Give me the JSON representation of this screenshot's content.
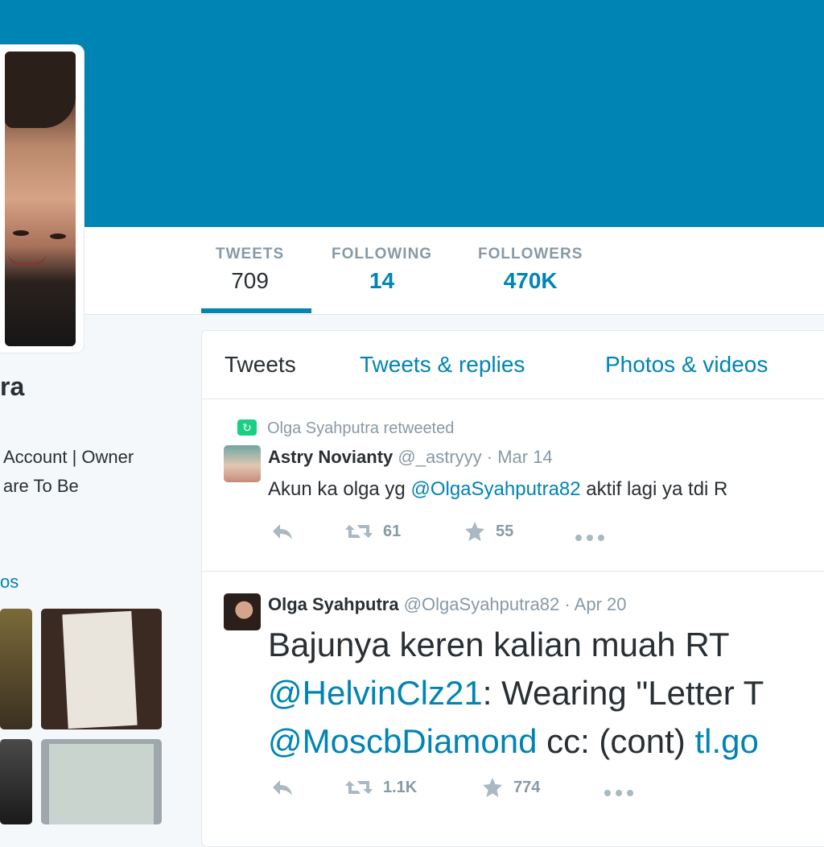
{
  "colors": {
    "banner": "#0084b4",
    "link": "#0084b4",
    "retweet": "#19cf86",
    "muted": "#8899a6"
  },
  "profile": {
    "name_partial": "ra",
    "bio_lines": [
      "Account | Owner",
      "are To Be"
    ],
    "photos_link_partial": "os"
  },
  "stats": [
    {
      "label": "TWEETS",
      "value": "709"
    },
    {
      "label": "FOLLOWING",
      "value": "14"
    },
    {
      "label": "FOLLOWERS",
      "value": "470K"
    }
  ],
  "tabs": [
    "Tweets",
    "Tweets & replies",
    "Photos & videos"
  ],
  "tweets": [
    {
      "retweet_note": "Olga Syahputra retweeted",
      "name": "Astry Novianty",
      "handle": "@_astryyy",
      "sep": "·",
      "date": "Mar 14",
      "text_before": "Akun ka olga yg ",
      "mention": "@OlgaSyahputra82",
      "text_after": " aktif lagi ya tdi R",
      "retweets": "61",
      "favorites": "55"
    },
    {
      "name": "Olga Syahputra",
      "handle": "@OlgaSyahputra82",
      "sep": "·",
      "date": "Apr 20",
      "line1": "Bajunya keren kalian muah RT",
      "line2_mention": "@HelvinClz21",
      "line2_text": ": Wearing \"Letter T",
      "line3_mention": "@MoscbDiamond",
      "line3_text": " cc: (cont) ",
      "line3_link": "tl.go",
      "retweets": "1.1K",
      "favorites": "774"
    }
  ],
  "icons": [
    "reply-icon",
    "retweet-icon",
    "favorite-star-icon",
    "more-icon"
  ]
}
